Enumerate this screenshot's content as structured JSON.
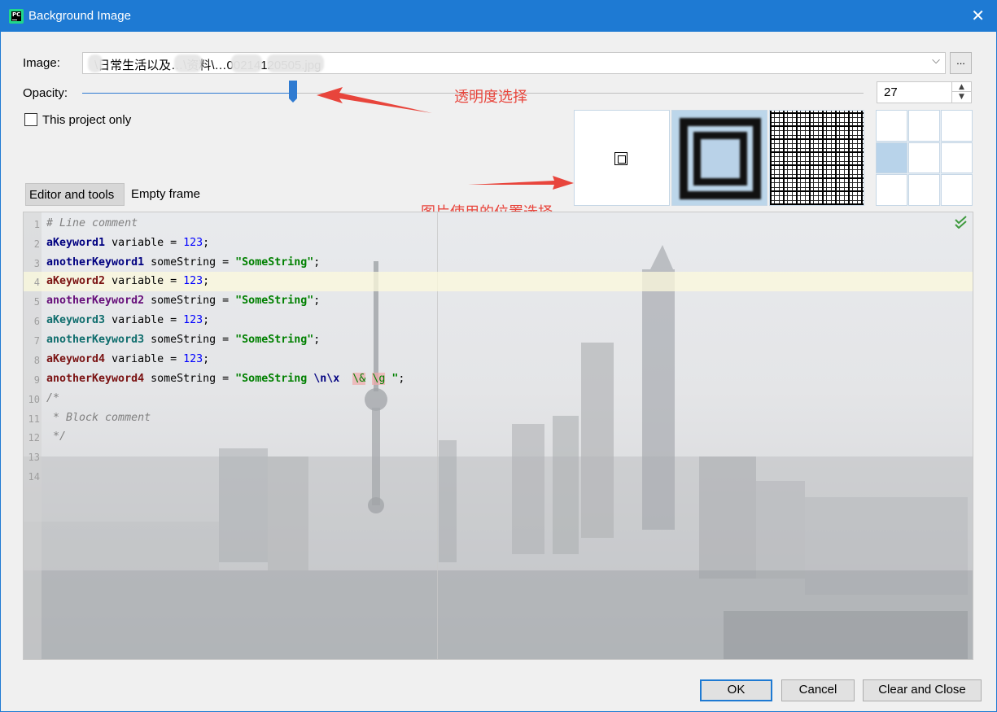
{
  "window": {
    "title": "Background Image",
    "app_icon": "pycharm-icon",
    "app_icon_text": "PC",
    "close_glyph": "✕",
    "accent_color": "#1e7ad3"
  },
  "image_field": {
    "label": "Image:",
    "value": "\\日常生活以及…\\资料\\…00214120505.jpg",
    "dropdown_glyph": "⌵",
    "browse_label": "..."
  },
  "opacity": {
    "label": "Opacity:",
    "value": "27",
    "fraction": 0.27,
    "spinner_up": "▲",
    "spinner_down": "▼"
  },
  "this_project_only": {
    "label": "This project only",
    "checked": false
  },
  "annotations": {
    "opacity_note": "透明度选择",
    "position_note": "图片使用的位置选择",
    "color": "#e8453c"
  },
  "fill_options": [
    "plain",
    "scale",
    "tile"
  ],
  "anchor_grid": {
    "cells": 9,
    "selected_index": 3
  },
  "tabs": [
    {
      "label": "Editor and tools",
      "active": true
    },
    {
      "label": "Empty frame",
      "active": false
    }
  ],
  "editor": {
    "line_numbers": [
      "1",
      "2",
      "3",
      "4",
      "5",
      "6",
      "7",
      "8",
      "9",
      "10",
      "11",
      "12",
      "13",
      "14"
    ],
    "current_line": 4,
    "lines": [
      "# Line comment",
      "aKeyword1 variable = 123;",
      "anotherKeyword1 someString = \"SomeString\";",
      "aKeyword2 variable = 123;",
      "anotherKeyword2 someString = \"SomeString\";",
      "aKeyword3 variable = 123;",
      "anotherKeyword3 someString = \"SomeString\";",
      "aKeyword4 variable = 123;",
      "anotherKeyword4 someString = \"SomeString \\n\\x  \\& \\g \";",
      "/*",
      " * Block comment",
      " */",
      "",
      ""
    ],
    "tokens": {
      "l1": "# Line comment",
      "k1": "aKeyword1",
      "k2": "anotherKeyword1",
      "k3": "aKeyword2",
      "k4": "anotherKeyword2",
      "k5": "aKeyword3",
      "k6": "anotherKeyword3",
      "k7": "aKeyword4",
      "k8": "anotherKeyword4",
      "var": " variable = ",
      "num": "123",
      "semi": ";",
      "some": " someString = ",
      "str": "\"SomeString\"",
      "str9a": "\"SomeString ",
      "esc9": "\\n\\x",
      "bad1": "\\&",
      "bad2": "\\g",
      "str9b": "\"",
      "c10": "/*",
      "c11": " * Block comment",
      "c12": " */"
    },
    "status_icon": "check-icon"
  },
  "buttons": {
    "ok": "OK",
    "cancel": "Cancel",
    "clear": "Clear and Close"
  }
}
